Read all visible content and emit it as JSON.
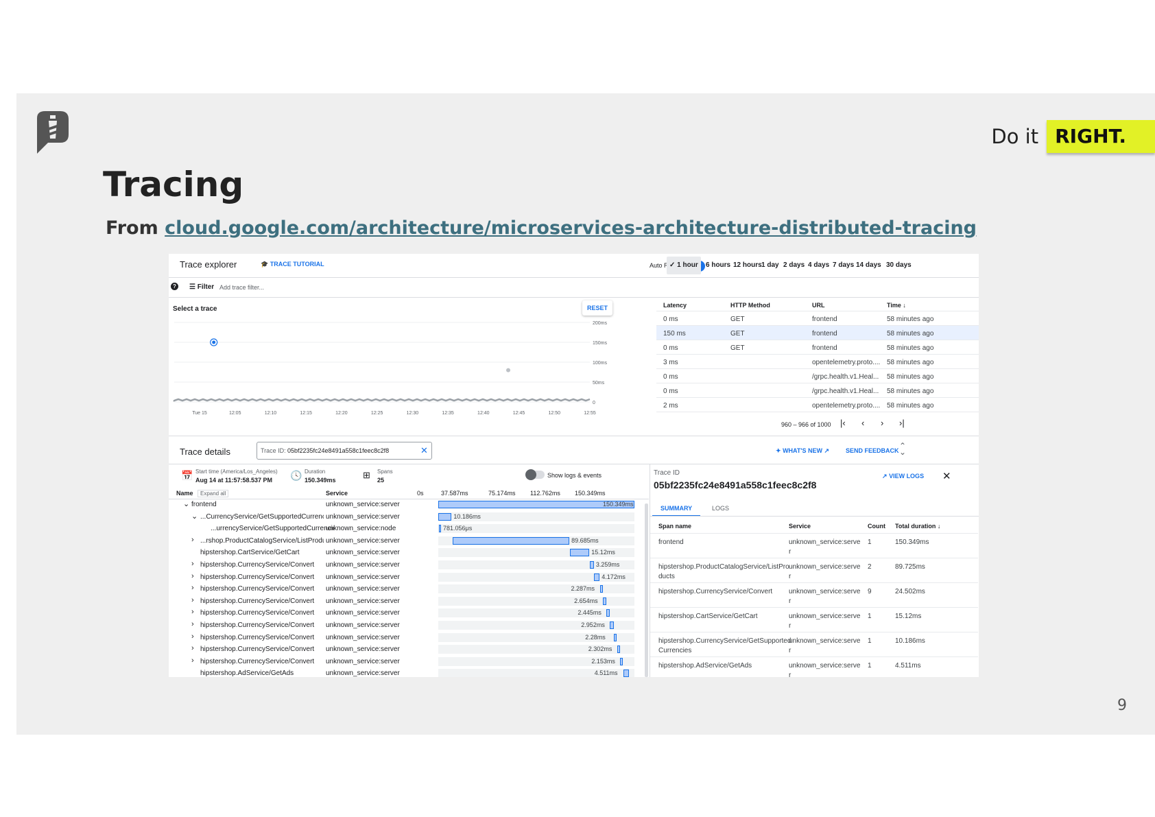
{
  "slide": {
    "title": "Tracing",
    "subtitle_prefix": "From ",
    "subtitle_link": "cloud.google.com/architecture/microservices-architecture-distributed-tracing",
    "brand_prefix": "Do it",
    "brand_highlight": "RIGHT.",
    "page_number": "9"
  },
  "explorer": {
    "title": "Trace explorer",
    "tutorial": "TRACE TUTORIAL",
    "auto_reload": "Auto Reload",
    "ranges": [
      "1 hour",
      "6 hours",
      "12 hours",
      "1 day",
      "2 days",
      "4 days",
      "7 days",
      "14 days",
      "30 days"
    ],
    "selected_range": "1 hour",
    "filter_label": "Filter",
    "filter_placeholder": "Add trace filter...",
    "select_trace": "Select a trace",
    "reset": "RESET"
  },
  "chart_data": {
    "type": "scatter",
    "title": "Select a trace",
    "ylabel": "",
    "y_ticks": [
      "200ms",
      "150ms",
      "100ms",
      "50ms",
      "0"
    ],
    "x_ticks": [
      "Tue 15",
      "12:05",
      "12:10",
      "12:15",
      "12:20",
      "12:25",
      "12:30",
      "12:35",
      "12:40",
      "12:45",
      "12:50",
      "12:55"
    ],
    "ylim": [
      0,
      200
    ],
    "points": [
      {
        "x_index": 0.4,
        "y": 150,
        "selected": true
      },
      {
        "x_index": 8.7,
        "y": 80,
        "selected": false
      }
    ]
  },
  "trace_table": {
    "headers": [
      "Latency",
      "HTTP Method",
      "URL",
      "Time"
    ],
    "rows": [
      [
        "0 ms",
        "GET",
        "frontend",
        "58 minutes ago"
      ],
      [
        "150 ms",
        "GET",
        "frontend",
        "58 minutes ago"
      ],
      [
        "0 ms",
        "GET",
        "frontend",
        "58 minutes ago"
      ],
      [
        "3 ms",
        "",
        "opentelemetry.proto....",
        "58 minutes ago"
      ],
      [
        "0 ms",
        "",
        "/grpc.health.v1.Heal...",
        "58 minutes ago"
      ],
      [
        "0 ms",
        "",
        "/grpc.health.v1.Heal...",
        "58 minutes ago"
      ],
      [
        "2 ms",
        "",
        "opentelemetry.proto....",
        "58 minutes ago"
      ]
    ],
    "highlighted_row": 1,
    "pagination": "960 – 966 of 1000"
  },
  "details": {
    "title": "Trace details",
    "trace_id_label": "Trace ID:",
    "trace_id": "05bf2235fc24e8491a558c1feec8c2f8",
    "whats_new": "WHAT'S NEW",
    "send_feedback": "SEND FEEDBACK",
    "start_label": "Start time (America/Los_Angeles)",
    "start_value": "Aug 14 at 11:57:58.537 PM",
    "duration_label": "Duration",
    "duration_value": "150.349ms",
    "spans_label": "Spans",
    "spans_value": "25",
    "show_logs": "Show logs & events",
    "col_name": "Name",
    "expand_all": "Expand all",
    "col_service": "Service",
    "timeline_ticks": [
      "0s",
      "37.587ms",
      "75.174ms",
      "112.762ms",
      "150.349ms"
    ],
    "total_ms": 150.349,
    "spans": [
      {
        "name": "frontend",
        "service": "unknown_service:server",
        "start": 0,
        "dur": 150.349,
        "label": "150.349ms",
        "indent": 0,
        "chev": "v"
      },
      {
        "name": "...CurrencyService/GetSupportedCurrencies",
        "service": "unknown_service:server",
        "start": 0,
        "dur": 10.186,
        "label": "10.186ms",
        "indent": 1,
        "chev": "v"
      },
      {
        "name": "...urrencyService/GetSupportedCurrencies",
        "service": "unknown_service:node",
        "start": 0.5,
        "dur": 0.781,
        "label": "781.056μs",
        "indent": 2,
        "chev": ""
      },
      {
        "name": "...rshop.ProductCatalogService/ListProducts",
        "service": "unknown_service:server",
        "start": 10.8,
        "dur": 89.685,
        "label": "89.685ms",
        "indent": 1,
        "chev": ">"
      },
      {
        "name": "hipstershop.CartService/GetCart",
        "service": "unknown_service:server",
        "start": 100.7,
        "dur": 15.12,
        "label": "15.12ms",
        "indent": 1,
        "chev": ""
      },
      {
        "name": "hipstershop.CurrencyService/Convert",
        "service": "unknown_service:server",
        "start": 116.0,
        "dur": 3.259,
        "label": "3.259ms",
        "indent": 1,
        "chev": ">"
      },
      {
        "name": "hipstershop.CurrencyService/Convert",
        "service": "unknown_service:server",
        "start": 119.5,
        "dur": 4.172,
        "label": "4.172ms",
        "indent": 1,
        "chev": ">"
      },
      {
        "name": "hipstershop.CurrencyService/Convert",
        "service": "unknown_service:server",
        "start": 123.8,
        "dur": 2.287,
        "label": "2.287ms",
        "indent": 1,
        "chev": ">"
      },
      {
        "name": "hipstershop.CurrencyService/Convert",
        "service": "unknown_service:server",
        "start": 126.2,
        "dur": 2.654,
        "label": "2.654ms",
        "indent": 1,
        "chev": ">"
      },
      {
        "name": "hipstershop.CurrencyService/Convert",
        "service": "unknown_service:server",
        "start": 129.0,
        "dur": 2.445,
        "label": "2.445ms",
        "indent": 1,
        "chev": ">"
      },
      {
        "name": "hipstershop.CurrencyService/Convert",
        "service": "unknown_service:server",
        "start": 131.6,
        "dur": 2.952,
        "label": "2.952ms",
        "indent": 1,
        "chev": ">"
      },
      {
        "name": "hipstershop.CurrencyService/Convert",
        "service": "unknown_service:server",
        "start": 134.7,
        "dur": 2.28,
        "label": "2.28ms",
        "indent": 1,
        "chev": ">"
      },
      {
        "name": "hipstershop.CurrencyService/Convert",
        "service": "unknown_service:server",
        "start": 137.1,
        "dur": 2.302,
        "label": "2.302ms",
        "indent": 1,
        "chev": ">"
      },
      {
        "name": "hipstershop.CurrencyService/Convert",
        "service": "unknown_service:server",
        "start": 139.5,
        "dur": 2.153,
        "label": "2.153ms",
        "indent": 1,
        "chev": ">"
      },
      {
        "name": "hipstershop.AdService/GetAds",
        "service": "unknown_service:server",
        "start": 141.8,
        "dur": 4.511,
        "label": "4.511ms",
        "indent": 1,
        "chev": ""
      }
    ]
  },
  "summary": {
    "trace_id_label": "Trace ID",
    "trace_id": "05bf2235fc24e8491a558c1feec8c2f8",
    "view_logs": "VIEW LOGS",
    "tabs": [
      "SUMMARY",
      "LOGS"
    ],
    "active_tab": 0,
    "headers": [
      "Span name",
      "Service",
      "Count",
      "Total duration"
    ],
    "rows": [
      [
        "frontend",
        "unknown_service:serve r",
        "1",
        "150.349ms"
      ],
      [
        "hipstershop.ProductCatalogService/ListPro ducts",
        "unknown_service:serve r",
        "2",
        "89.725ms"
      ],
      [
        "hipstershop.CurrencyService/Convert",
        "unknown_service:serve r",
        "9",
        "24.502ms"
      ],
      [
        "hipstershop.CartService/GetCart",
        "unknown_service:serve r",
        "1",
        "15.12ms"
      ],
      [
        "hipstershop.CurrencyService/GetSupported Currencies",
        "unknown_service:serve r",
        "1",
        "10.186ms"
      ],
      [
        "hipstershop.AdService/GetAds",
        "unknown_service:serve r",
        "1",
        "4.511ms"
      ]
    ]
  },
  "colors": {
    "accent": "#1a73e8",
    "brand_highlight": "#e2f126",
    "link": "#3d6f7f",
    "bar_fill": "#aecbfa"
  },
  "icons": [
    "logo-icon",
    "graduation-cap-icon",
    "check-icon",
    "help-icon",
    "filter-icon",
    "first-page-icon",
    "prev-icon",
    "next-icon",
    "last-page-icon",
    "close-icon",
    "sparkle-icon",
    "external-link-icon",
    "expand-icon",
    "calendar-icon",
    "clock-icon",
    "spans-icon",
    "chevron-icon",
    "sort-down-icon"
  ]
}
